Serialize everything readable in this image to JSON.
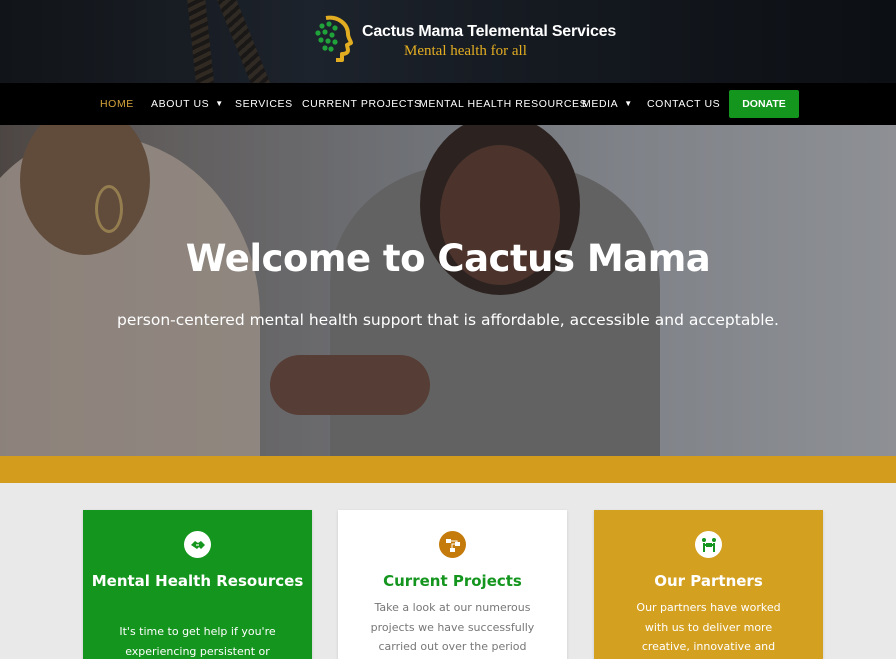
{
  "brand": {
    "title": "Cactus Mama Telemental Services",
    "tagline": "Mental health for all"
  },
  "nav": {
    "items": [
      {
        "label": "HOME",
        "active": true,
        "has_dropdown": false
      },
      {
        "label": "ABOUT US",
        "active": false,
        "has_dropdown": true
      },
      {
        "label": "SERVICES",
        "active": false,
        "has_dropdown": false
      },
      {
        "label": "CURRENT PROJECTS",
        "active": false,
        "has_dropdown": false
      },
      {
        "label": "MENTAL HEALTH RESOURCES",
        "active": false,
        "has_dropdown": false
      },
      {
        "label": "MEDIA",
        "active": false,
        "has_dropdown": true
      },
      {
        "label": "CONTACT US",
        "active": false,
        "has_dropdown": false
      }
    ],
    "donate_label": "DONATE"
  },
  "hero": {
    "title": "Welcome to Cactus Mama",
    "subtitle": "person-centered mental health support that is affordable, accessible and acceptable."
  },
  "cards": [
    {
      "title": "Mental Health Resources",
      "text": "It's time to get help if you're experiencing persistent or",
      "icon": "handshake-icon"
    },
    {
      "title": "Current Projects",
      "text": "Take a look at our numerous projects we have successfully carried out over the period",
      "icon": "project-diagram-icon"
    },
    {
      "title": "Our Partners",
      "text": "Our partners have worked with us to deliver more creative, innovative and",
      "icon": "people-carry-icon"
    }
  ],
  "colors": {
    "brand_green": "#14951e",
    "brand_gold": "#d4a020",
    "nav_active": "#d6a33b",
    "projects_icon": "#c47b0c"
  }
}
